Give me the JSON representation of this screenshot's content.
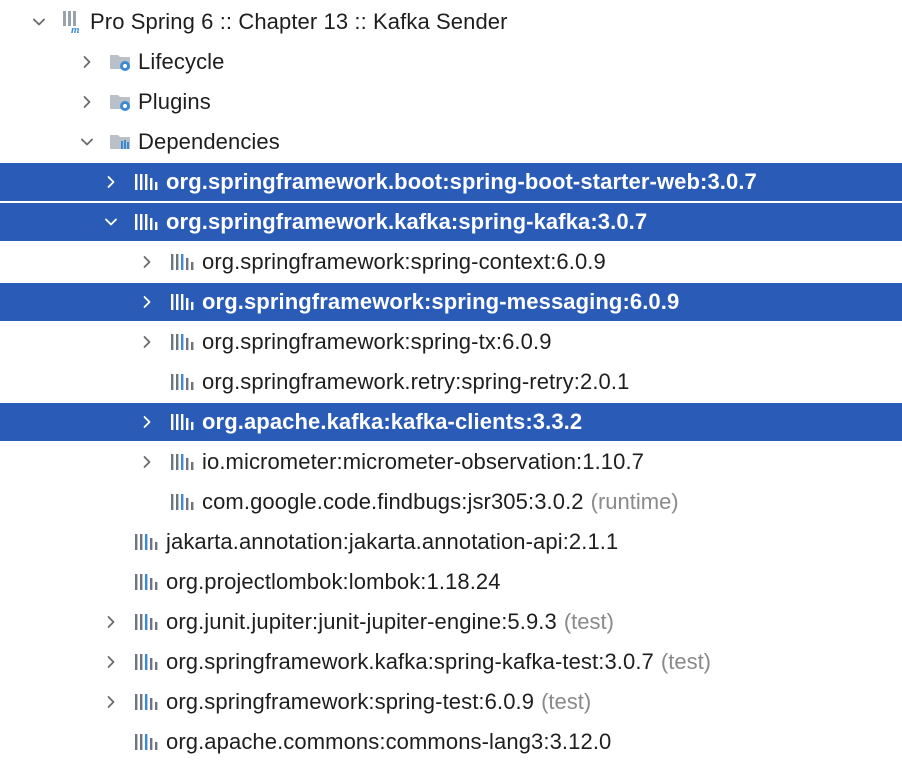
{
  "tree": {
    "root": {
      "label": "Pro Spring 6 :: Chapter 13 :: Kafka Sender",
      "expanded": true,
      "icon": "maven-module-icon"
    },
    "lifecycle": {
      "label": "Lifecycle",
      "expanded": false,
      "icon": "lifecycle-folder-icon"
    },
    "plugins": {
      "label": "Plugins",
      "expanded": false,
      "icon": "plugins-folder-icon"
    },
    "dependencies": {
      "label": "Dependencies",
      "expanded": true,
      "icon": "dependencies-folder-icon"
    },
    "deps": [
      {
        "label": "org.springframework.boot:spring-boot-starter-web:3.0.7",
        "scope": "",
        "selected": true,
        "chevron": "right"
      },
      {
        "label": "org.springframework.kafka:spring-kafka:3.0.7",
        "scope": "",
        "selected": true,
        "chevron": "down"
      },
      {
        "label": "org.springframework:spring-context:6.0.9",
        "scope": "",
        "selected": false,
        "chevron": "right"
      },
      {
        "label": "org.springframework:spring-messaging:6.0.9",
        "scope": "",
        "selected": true,
        "chevron": "right"
      },
      {
        "label": "org.springframework:spring-tx:6.0.9",
        "scope": "",
        "selected": false,
        "chevron": "right"
      },
      {
        "label": "org.springframework.retry:spring-retry:2.0.1",
        "scope": "",
        "selected": false,
        "chevron": "none"
      },
      {
        "label": "org.apache.kafka:kafka-clients:3.3.2",
        "scope": "",
        "selected": true,
        "chevron": "right"
      },
      {
        "label": "io.micrometer:micrometer-observation:1.10.7",
        "scope": "",
        "selected": false,
        "chevron": "right"
      },
      {
        "label": "com.google.code.findbugs:jsr305:3.0.2",
        "scope": "(runtime)",
        "selected": false,
        "chevron": "none"
      },
      {
        "label": "jakarta.annotation:jakarta.annotation-api:2.1.1",
        "scope": "",
        "selected": false,
        "chevron": "none"
      },
      {
        "label": "org.projectlombok:lombok:1.18.24",
        "scope": "",
        "selected": false,
        "chevron": "none"
      },
      {
        "label": "org.junit.jupiter:junit-jupiter-engine:5.9.3",
        "scope": "(test)",
        "selected": false,
        "chevron": "right"
      },
      {
        "label": "org.springframework.kafka:spring-kafka-test:3.0.7",
        "scope": "(test)",
        "selected": false,
        "chevron": "right"
      },
      {
        "label": "org.springframework:spring-test:6.0.9",
        "scope": "(test)",
        "selected": false,
        "chevron": "right"
      },
      {
        "label": "org.apache.commons:commons-lang3:3.12.0",
        "scope": "",
        "selected": false,
        "chevron": "none"
      }
    ],
    "icons": {
      "library": "library-icon"
    },
    "colors": {
      "selection": "#2a5bb7",
      "scope_text": "#8a8a8a",
      "text": "#1e1e1e"
    }
  }
}
